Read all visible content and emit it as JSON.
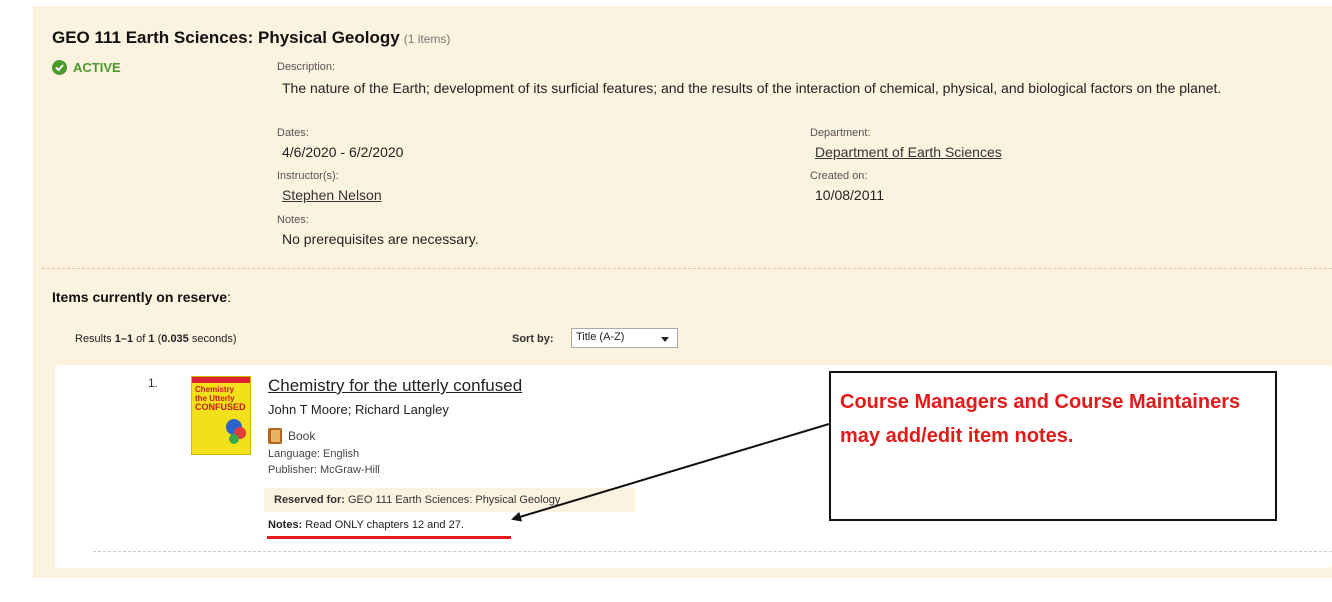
{
  "course": {
    "title": "GEO 111 Earth Sciences: Physical Geology",
    "item_count": "(1 items)",
    "status": "ACTIVE",
    "description_label": "Description:",
    "description": "The nature of the Earth; development of its surficial features; and the results of the interaction of chemical, physical, and biological factors on the planet.",
    "dates_label": "Dates:",
    "dates": "4/6/2020 - 6/2/2020",
    "instructor_label": "Instructor(s):",
    "instructor": "Stephen Nelson",
    "notes_label": "Notes:",
    "notes": "No prerequisites are necessary.",
    "department_label": "Department:",
    "department": "Department of Earth Sciences",
    "created_label": "Created on:",
    "created": "10/08/2011"
  },
  "reserve": {
    "heading_bold": "Items currently on reserve",
    "heading_colon": ":",
    "results_prefix": "Results ",
    "results_range": "1–1",
    "results_of": " of ",
    "results_total": "1",
    "results_time_open": " (",
    "results_time": "0.035",
    "results_time_close": " seconds)",
    "sort_label": "Sort by:",
    "sort_value": "Title (A-Z)"
  },
  "item": {
    "number": "1.",
    "cover_lines": [
      "Chemistry",
      "the Utterly",
      "CONFUSED"
    ],
    "title": "Chemistry for the utterly confused",
    "authors": "John T Moore; Richard Langley",
    "format": "Book",
    "language": "Language: English",
    "publisher": "Publisher: McGraw-Hill",
    "reserved_label": "Reserved for:",
    "reserved_value": " GEO 111 Earth Sciences: Physical Geology",
    "notes_label": "Notes:",
    "notes_value": " Read ONLY chapters 12 and 27."
  },
  "callout": {
    "text": "Course Managers and Course Maintainers may add/edit item notes."
  },
  "colors": {
    "panel": "#fcf2e0",
    "active_green": "#4a9a2c",
    "annotation_red": "#e21a1a"
  }
}
